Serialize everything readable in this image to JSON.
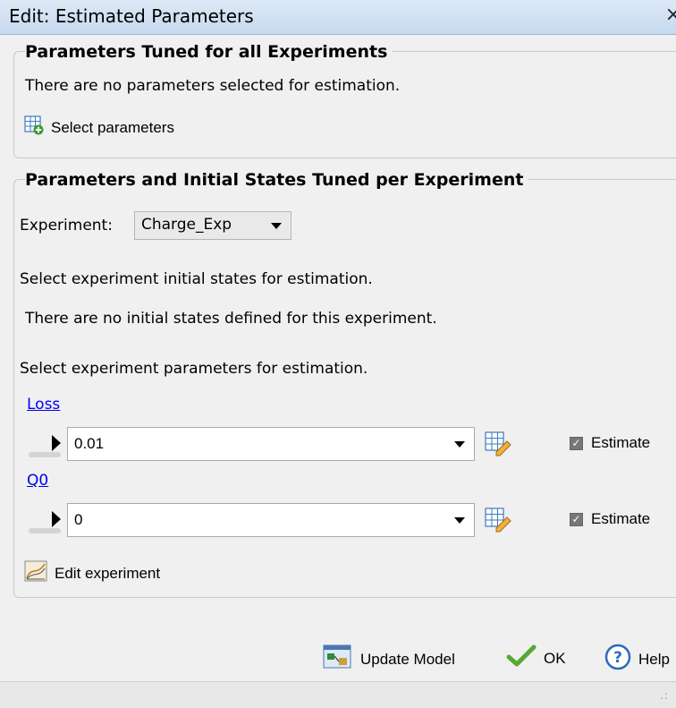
{
  "window": {
    "title": "Edit: Estimated Parameters",
    "close_symbol": "×"
  },
  "section1": {
    "heading": "Parameters Tuned for all Experiments",
    "message": "There are no parameters selected for estimation.",
    "select_button": {
      "label": "Select parameters",
      "icon": "table-add-icon"
    }
  },
  "section2": {
    "heading": "Parameters and Initial States Tuned per Experiment",
    "experiment_label": "Experiment:",
    "experiment_value": "Charge_Exp",
    "initial_states_prompt": "Select experiment initial states for estimation.",
    "initial_states_message": "There are no initial states defined for this experiment.",
    "parameters_prompt": "Select experiment parameters for estimation.",
    "parameters": [
      {
        "name": "Loss",
        "value": "0.01",
        "estimate_label": "Estimate",
        "estimate_checked": true
      },
      {
        "name": "Q0",
        "value": "0",
        "estimate_label": "Estimate",
        "estimate_checked": true
      }
    ],
    "edit_experiment_label": "Edit experiment"
  },
  "footer": {
    "update_model_label": "Update Model",
    "ok_label": "OK",
    "help_label": "Help"
  },
  "colors": {
    "link": "#0000ee",
    "check_green": "#5aa832",
    "help_blue": "#2b6cb8"
  }
}
